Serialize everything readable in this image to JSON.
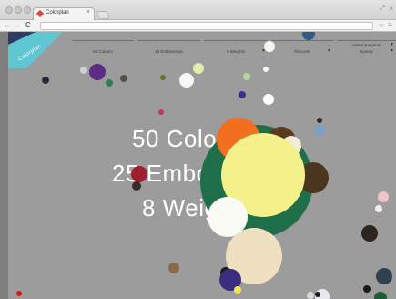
{
  "browser": {
    "tab_title": "Colorplan",
    "tab_close": "×",
    "nav_back": "←",
    "nav_forward": "→",
    "nav_reload": "C",
    "star_icon": "☆",
    "menu_icon": "≡"
  },
  "site": {
    "logo": "Colorplan",
    "nav": [
      {
        "label": "50 Colours",
        "caret": ""
      },
      {
        "label": "25 Embossings",
        "caret": ""
      },
      {
        "label": "8 Weights",
        "caret": "▼"
      },
      {
        "label": "Discover",
        "caret": "▼"
      },
      {
        "label": "United Kingdom",
        "caret": "▼"
      },
      {
        "label": "Specify",
        "caret": "▼"
      }
    ],
    "hero_lines": [
      "50 Colours",
      "25 Embossings",
      "8 Weights"
    ]
  },
  "colors": {
    "page_background": "#9c9c9c",
    "logo_teal": "#5fc7d2",
    "logo_navy": "#2d3b66",
    "circles": [
      "#f4f08a",
      "#1e6e4a",
      "#f07020",
      "#fbfbf5",
      "#eee0c0",
      "#3b2e7e",
      "#4a351f",
      "#9d1f2f"
    ]
  }
}
